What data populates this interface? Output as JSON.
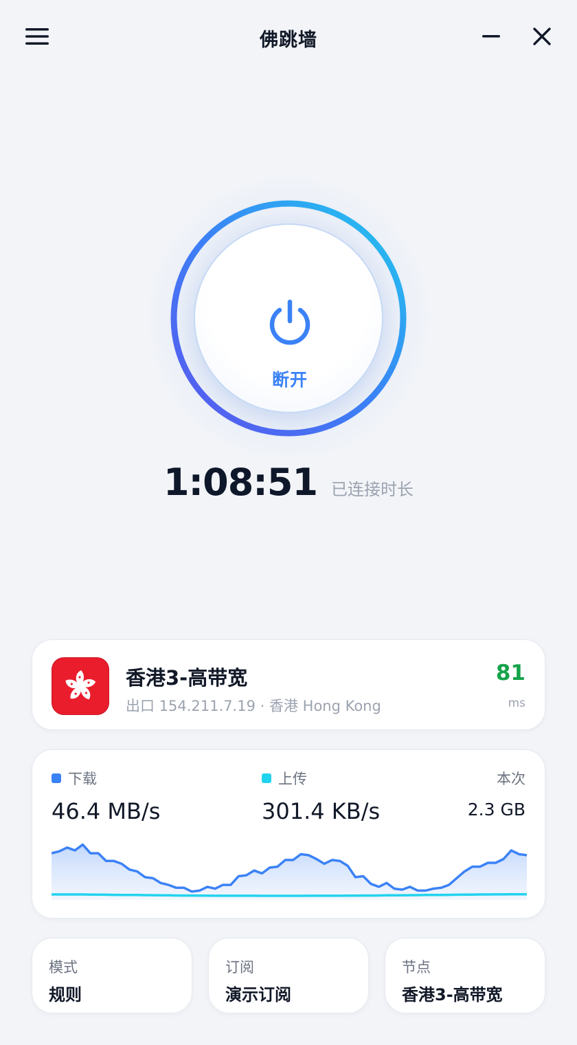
{
  "app": {
    "title": "佛跳墙"
  },
  "power": {
    "label": "断开"
  },
  "session": {
    "duration": "1:08:51",
    "duration_label": "已连接时长"
  },
  "node": {
    "name": "香港3-高带宽",
    "detail": "出口 154.211.7.19 · 香港 Hong Kong",
    "latency": "81",
    "latency_unit": "ms",
    "region_flag": "hong-kong-flag"
  },
  "traffic": {
    "download_label": "下载",
    "download_value": "46.4 MB/s",
    "upload_label": "上传",
    "upload_value": "301.4 KB/s",
    "total_label": "本次",
    "total_value": "2.3 GB",
    "download_series": [
      31,
      33,
      37,
      34,
      40,
      31,
      31,
      23,
      23,
      20,
      14,
      12,
      6,
      5,
      0,
      -2,
      -5,
      -5,
      -9,
      -8,
      -4,
      -6,
      -2,
      -2,
      7,
      8,
      13,
      10,
      16,
      17,
      24,
      24,
      30,
      29,
      25,
      20,
      24,
      23,
      18,
      6,
      7,
      -1,
      -4,
      0,
      -6,
      -7,
      -4,
      -8,
      -8,
      -6,
      -5,
      -2,
      5,
      12,
      17,
      17,
      21,
      21,
      25,
      34,
      30,
      29
    ],
    "upload_series": [
      1.5,
      1.5,
      1.5,
      1.5,
      1.5,
      1.4,
      1.3,
      1.2,
      1.1,
      1,
      0.9,
      0.9,
      0.8,
      0.7,
      0.6,
      0.5,
      0.4,
      0.3,
      0.3,
      0.2,
      0.2,
      0.1,
      0.1,
      0.1,
      0.1,
      0.1,
      0.1,
      0,
      0,
      0,
      0,
      0,
      0,
      0.1,
      0.1,
      0.1,
      0.1,
      0.1,
      0.2,
      0.2,
      0.3,
      0.3,
      0.4,
      0.5,
      0.5,
      0.6,
      0.7,
      0.8,
      0.9,
      0.9,
      1,
      1.1,
      1.2,
      1.3,
      1.4,
      1.5,
      1.5,
      1.6,
      1.6,
      1.7,
      1.8,
      1.8
    ],
    "download_color": "#3b82f6",
    "upload_color": "#22d3ee"
  },
  "tiles": [
    {
      "label": "模式",
      "value": "规则"
    },
    {
      "label": "订阅",
      "value": "演示订阅"
    },
    {
      "label": "节点",
      "value": "香港3-高带宽"
    }
  ],
  "colors": {
    "accent": "#3b82f6",
    "ring_start": "#22c8ee",
    "ring_end": "#5b57ee",
    "latency_good": "#16a34a",
    "flag_red": "#ea1d2c"
  }
}
